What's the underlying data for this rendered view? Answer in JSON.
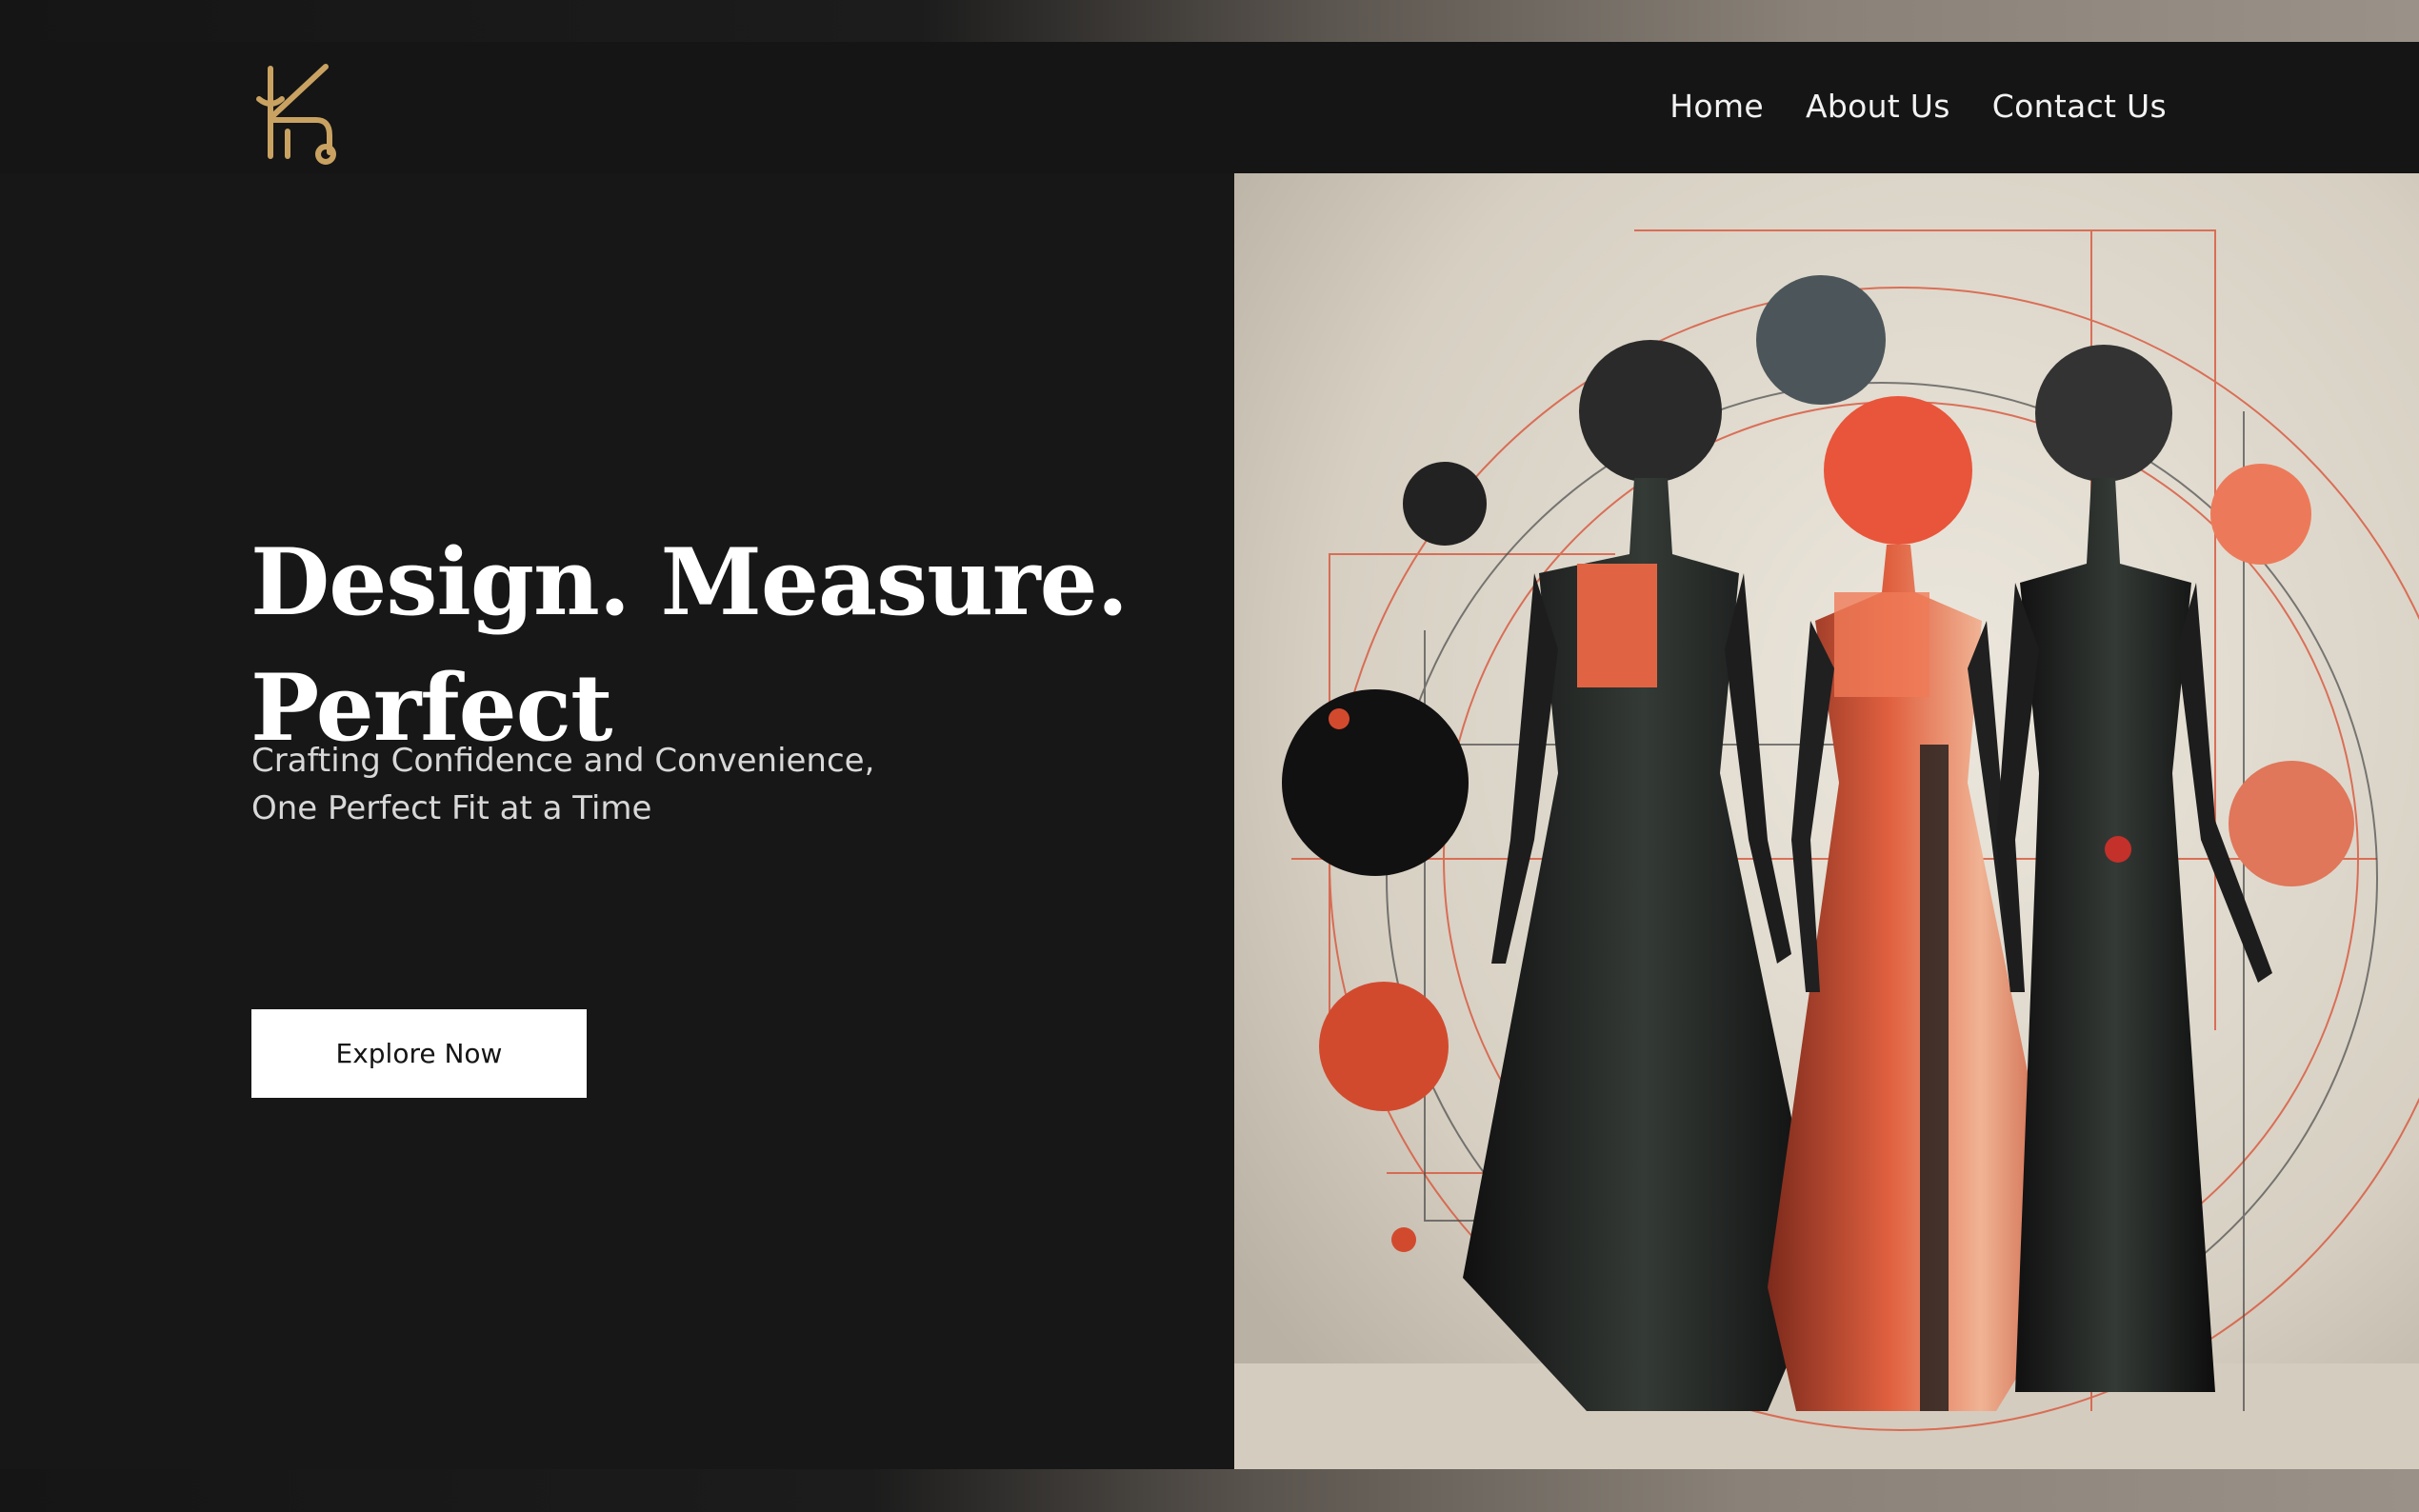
{
  "brand": {
    "logo_icon": "k-monogram-logo-icon",
    "color": "#c9a262"
  },
  "nav": {
    "items": [
      {
        "label": "Home"
      },
      {
        "label": "About Us"
      },
      {
        "label": "Contact Us"
      }
    ]
  },
  "hero": {
    "headline_line1": "Design. Measure.",
    "headline_line2": "Perfect",
    "subtitle_line1": "Crafting Confidence and Convenience,",
    "subtitle_line2": "One Perfect Fit at a Time",
    "cta_label": "Explore Now"
  },
  "colors": {
    "background": "#151515",
    "accent": "#d9553a",
    "button_bg": "#ffffff",
    "text": "#ffffff"
  }
}
